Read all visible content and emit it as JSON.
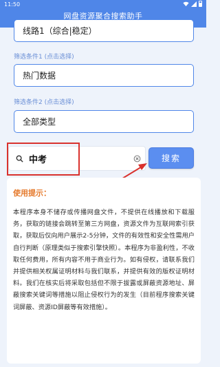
{
  "status_bar": {
    "time": "11:50"
  },
  "header": {
    "title": "网盘资源聚合搜索助手"
  },
  "line_select": {
    "value": "线路1（综合|稳定）"
  },
  "condition1": {
    "label": "筛选条件1 (点击选择)",
    "value": "热门数据"
  },
  "condition2": {
    "label": "筛选条件2 (点击选择)",
    "value": "全部类型"
  },
  "search": {
    "value": "中考",
    "button_label": "搜索"
  },
  "tips": {
    "title": "使用提示：",
    "body": "本程序本身不储存或传播网盘文件，不提供在线播放和下载服务，获取的链接会跳转至第三方网盘，资源文件为互联网索引获取，获取后仅向用户展示2-5分钟，文件的有效性和安全性需用户自行判断（原理类似于搜索引擎快照）。本程序为非盈利性，不收取任何费用，所有内容不用于商业行为。如有侵权，请联系我们并提供相关权属证明材料与我们联系，并提供有效的版权证明材料。我们在核实后将采取包括但不限于拔露或屏蔽资源地址、屏蔽搜索关键词等措施以阻止侵权行为的发生（目前程序搜索关键词屏蔽、资源ID屏蔽等有效措施）。"
  },
  "colors": {
    "primary": "#4f86e8",
    "button": "#5b8ef0",
    "highlight_red": "#d9312d",
    "tips_title": "#e5792b",
    "background": "#eef3fb"
  },
  "icons": {
    "search": "magnifier",
    "clear": "circle-x",
    "wifi": "wifi",
    "signal": "signal",
    "battery": "battery"
  }
}
